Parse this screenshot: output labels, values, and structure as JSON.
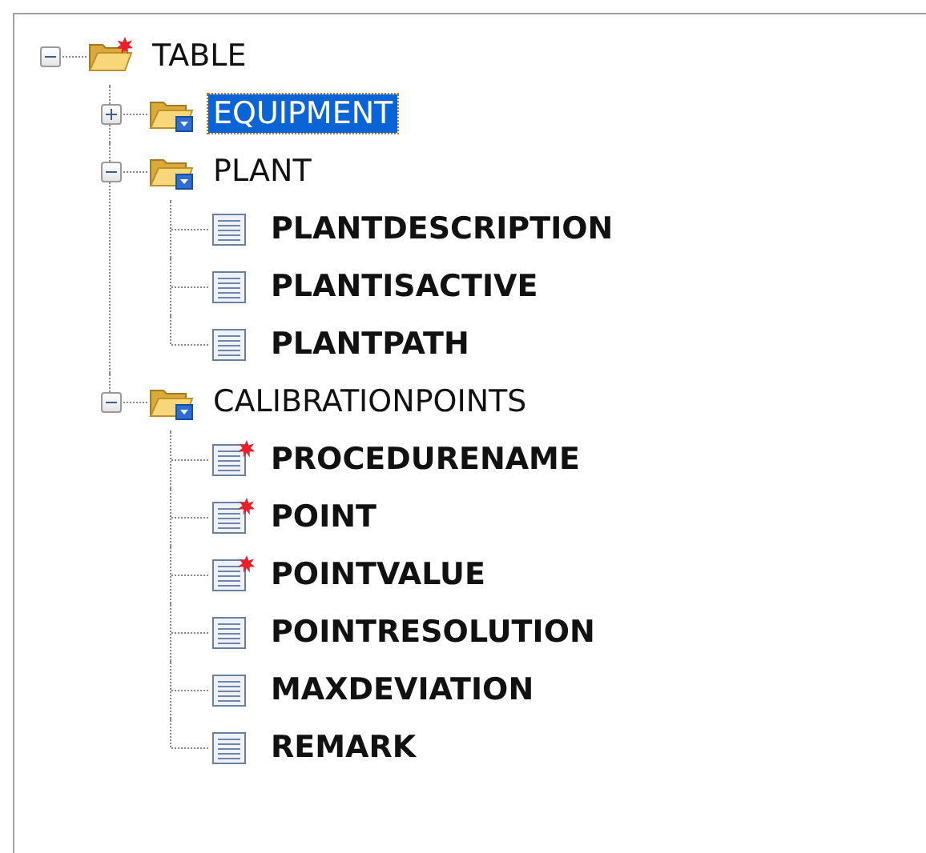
{
  "tree": [
    {
      "label": "TABLE",
      "kind": "root",
      "required": true,
      "expanded": true,
      "selected": false,
      "children": [
        {
          "label": "EQUIPMENT",
          "kind": "folder",
          "required": false,
          "expanded": false,
          "selected": true
        },
        {
          "label": "PLANT",
          "kind": "folder",
          "required": false,
          "expanded": true,
          "selected": false,
          "children": [
            {
              "label": "PLANTDESCRIPTION",
              "kind": "field",
              "required": false,
              "selected": false
            },
            {
              "label": "PLANTISACTIVE",
              "kind": "field",
              "required": false,
              "selected": false
            },
            {
              "label": "PLANTPATH",
              "kind": "field",
              "required": false,
              "selected": false
            }
          ]
        },
        {
          "label": "CALIBRATIONPOINTS",
          "kind": "folder",
          "required": false,
          "expanded": true,
          "selected": false,
          "children": [
            {
              "label": "PROCEDURENAME",
              "kind": "field",
              "required": true,
              "selected": false
            },
            {
              "label": "POINT",
              "kind": "field",
              "required": true,
              "selected": false
            },
            {
              "label": "POINTVALUE",
              "kind": "field",
              "required": true,
              "selected": false
            },
            {
              "label": "POINTRESOLUTION",
              "kind": "field",
              "required": false,
              "selected": false
            },
            {
              "label": "MAXDEVIATION",
              "kind": "field",
              "required": false,
              "selected": false
            },
            {
              "label": "REMARK",
              "kind": "field",
              "required": false,
              "selected": false
            }
          ]
        }
      ]
    }
  ]
}
